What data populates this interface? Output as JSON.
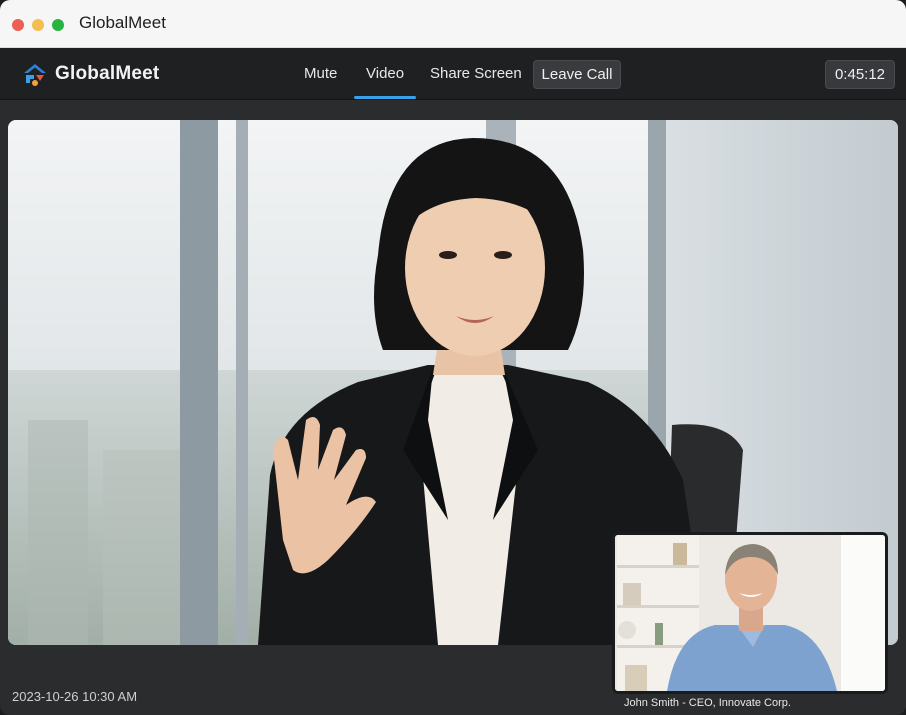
{
  "window": {
    "title": "GlobalMeet"
  },
  "toolbar": {
    "brand": "GlobalMeet",
    "nav": [
      {
        "label": "Mute"
      },
      {
        "label": "Video",
        "active": true
      },
      {
        "label": "Share Screen"
      }
    ],
    "leave_label": "Leave Call",
    "timer": "0:45:12"
  },
  "main_video": {
    "icon": "speaker-video"
  },
  "footer": {
    "timestamp": "2023-10-26 10:30 AM"
  },
  "pip": {
    "caption": "John Smith - CEO, Innovate Corp."
  },
  "colors": {
    "accent": "#3aa0e8",
    "logo_blue": "#2f7fd8",
    "logo_red": "#e8533b"
  }
}
